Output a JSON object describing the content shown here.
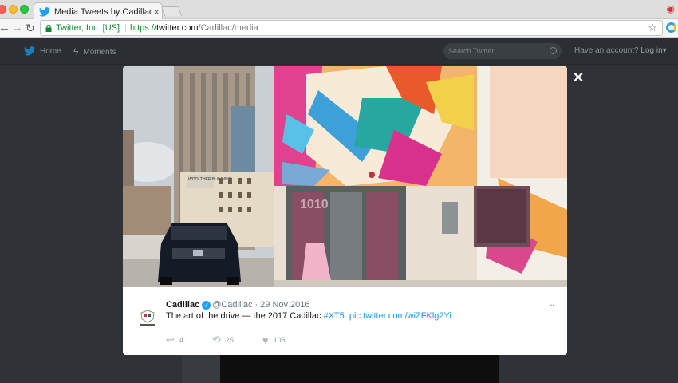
{
  "browser": {
    "tab_title": "Media Tweets by Cadillac (@C",
    "tab_close": "×",
    "secure_label": "Twitter, Inc. [US]",
    "url_scheme": "https://",
    "url_host": "twitter.com",
    "url_path": "/Cadillac/media",
    "icons": [
      "back-icon",
      "forward-icon",
      "reload-icon",
      "lock-icon",
      "star-icon"
    ]
  },
  "twitter_nav": {
    "home": "Home",
    "moments": "Moments",
    "search_placeholder": "Search Twitter",
    "account_prompt": "Have an account?",
    "login": "Log in",
    "login_caret": "▾"
  },
  "modal": {
    "close": "×",
    "mural_label": "WOOLTHER BUILDING",
    "door_number": "1010",
    "tweet": {
      "author": "Cadillac",
      "verified": "✓",
      "handle": "@Cadillac",
      "separator": "·",
      "date": "29 Nov 2016",
      "text": "The art of the drive — the 2017 Cadillac ",
      "hashtag": "#XT5",
      "text_after_hashtag": ". ",
      "link": "pic.twitter.com/wiZFKlg2Yi",
      "replies": "4",
      "retweets": "25",
      "likes": "106"
    }
  },
  "colors": {
    "twitter_blue": "#1da1f2",
    "link_blue": "#1b95e0",
    "secure_green": "#0a8a32"
  }
}
